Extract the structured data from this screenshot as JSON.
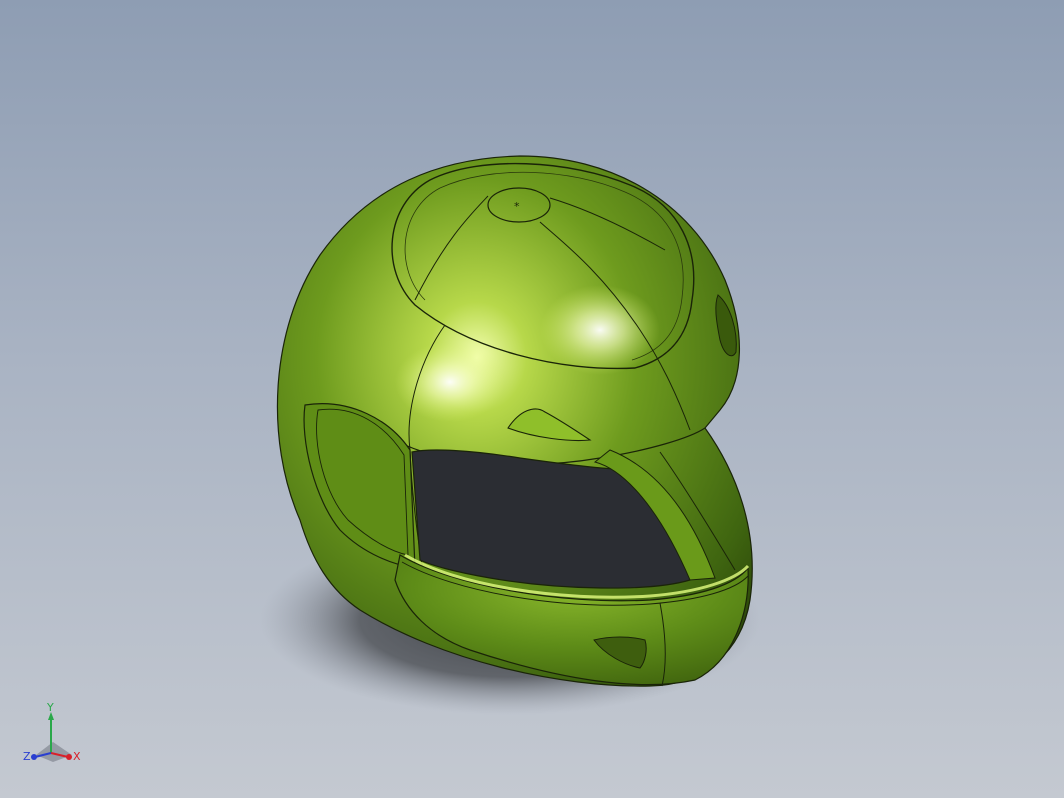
{
  "viewport": {
    "background_top": "#8e9db3",
    "background_bottom": "#c4c9d1"
  },
  "model": {
    "part_color": "#6e9b1e",
    "edge_color": "#1a2408",
    "visor_opening_color": "#2b2d33",
    "shadow_color": "#4a4d52"
  },
  "triad": {
    "x_label": "X",
    "y_label": "Y",
    "z_label": "Z",
    "x_color": "#d8202a",
    "y_color": "#2aa84a",
    "z_color": "#2a3fd0"
  }
}
